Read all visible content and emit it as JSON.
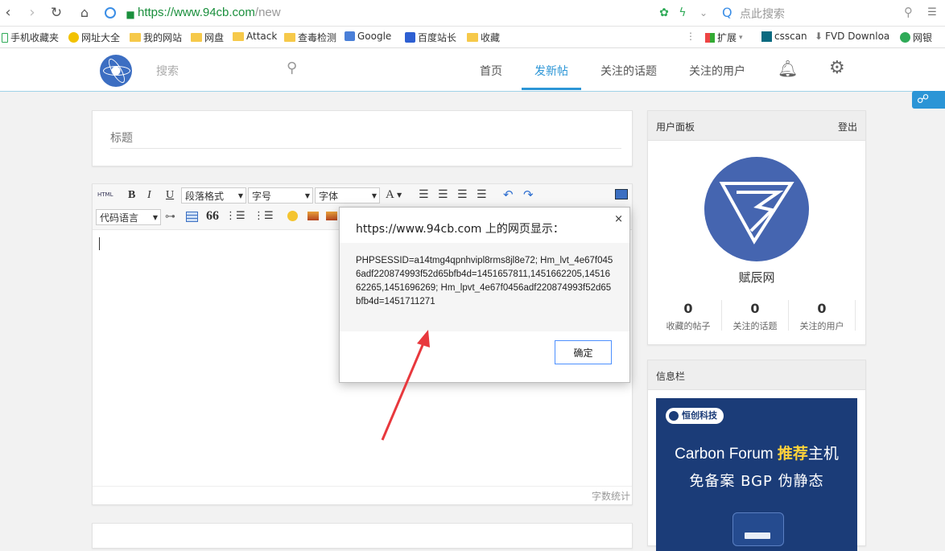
{
  "browser": {
    "url_host": "https://www.94cb.com",
    "url_path": "/new",
    "search_placeholder": "点此搜索"
  },
  "bookmarks": [
    "手机收藏夹",
    "网址大全",
    "我的网站",
    "网盘",
    "Attack",
    "查毒检测",
    "Google",
    "百度站长",
    "收藏"
  ],
  "bookmarks_right": [
    "扩展",
    "csscan",
    "FVD Downloa",
    "网银"
  ],
  "site": {
    "search_placeholder": "搜索",
    "nav": [
      "首页",
      "发新帖",
      "关注的话题",
      "关注的用户"
    ]
  },
  "editor": {
    "title_placeholder": "标题",
    "html_label": "HTML",
    "bold": "B",
    "italic": "I",
    "underline": "U",
    "paragraph_format": "段落格式",
    "font_size": "字号",
    "font_family": "字体",
    "font_color": "A",
    "code_language": "代码语言",
    "quote": "66",
    "word_count": "字数统计"
  },
  "user_panel": {
    "title": "用户面板",
    "logout": "登出",
    "username": "赋辰网",
    "stats": [
      {
        "value": "0",
        "label": "收藏的帖子"
      },
      {
        "value": "0",
        "label": "关注的话题"
      },
      {
        "value": "0",
        "label": "关注的用户"
      }
    ]
  },
  "info_panel": {
    "title": "信息栏",
    "ad_badge": "恒创科技",
    "ad_title_a": "Carbon Forum ",
    "ad_title_b": "推荐",
    "ad_title_c": "主机",
    "ad_subtitle": "免备案 BGP 伪静态"
  },
  "dialog": {
    "title": "https://www.94cb.com 上的网页显示：",
    "close": "×",
    "message": "PHPSESSID=a14tmg4qpnhvipl8rms8jl8e72; Hm_lvt_4e67f0456adf220874993f52d65bfb4d=1451657811,1451662205,1451662265,1451696269; Hm_lpvt_4e67f0456adf220874993f52d65bfb4d=1451711271",
    "ok": "确定"
  },
  "colors": {
    "accent": "#2b95d6",
    "annotation_arrow": "#e8383d",
    "avatar_bg": "#4565b0",
    "ad_bg": "#1b3c78"
  }
}
